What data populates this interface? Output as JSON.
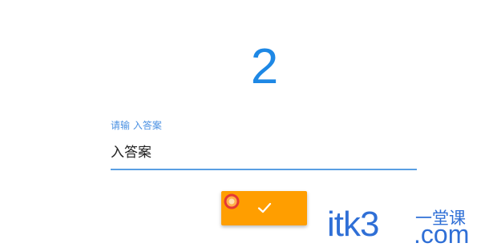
{
  "question": {
    "number": "2"
  },
  "answer_field": {
    "label": "请输 入答案",
    "value": "入答案",
    "accent_color": "#5a9fe3"
  },
  "confirm": {
    "icon": "check-icon",
    "color": "#ff9e00"
  },
  "watermark": {
    "main": "itk3",
    "sub": "一堂课",
    "suffix": ".com",
    "color": "#2f6fd6"
  }
}
